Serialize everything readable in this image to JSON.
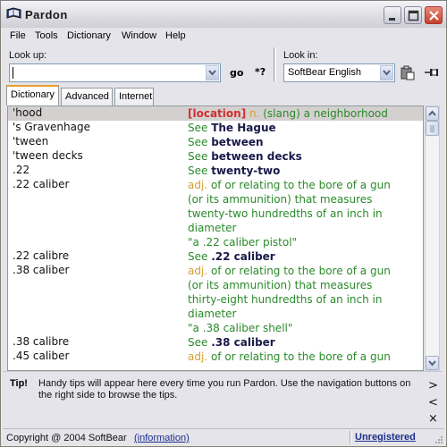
{
  "window": {
    "title": "Pardon",
    "icon": "book-icon"
  },
  "titlebar_buttons": {
    "minimize": "minimize-icon",
    "maximize": "maximize-icon",
    "close": "close-icon"
  },
  "menu": [
    "File",
    "Tools",
    "Dictionary",
    "Window",
    "Help"
  ],
  "lookup": {
    "label": "Look up:",
    "value": "",
    "go_label": "go",
    "wildcard_label": "*?"
  },
  "lookin": {
    "label": "Look in:",
    "value": "SoftBear English",
    "paste_icon": "clipboard-paste-icon",
    "pin_icon": "pin-icon"
  },
  "tabs": [
    "Dictionary",
    "Advanced",
    "Internet"
  ],
  "active_tab": "Dictionary",
  "entries": [
    {
      "term": "'hood",
      "selected": true,
      "lines": [
        [
          {
            "t": "tag",
            "v": "[location]"
          },
          {
            "t": "pos",
            "v": " n."
          },
          {
            "t": "txt",
            "v": " (slang) a neighborhood"
          }
        ]
      ]
    },
    {
      "term": "'s Gravenhage",
      "lines": [
        [
          {
            "t": "see",
            "v": "See "
          },
          {
            "t": "ref",
            "v": "The Hague"
          }
        ]
      ]
    },
    {
      "term": "'tween",
      "lines": [
        [
          {
            "t": "see",
            "v": "See "
          },
          {
            "t": "ref",
            "v": "between"
          }
        ]
      ]
    },
    {
      "term": "'tween decks",
      "lines": [
        [
          {
            "t": "see",
            "v": "See "
          },
          {
            "t": "ref",
            "v": "between decks"
          }
        ]
      ]
    },
    {
      "term": ".22",
      "lines": [
        [
          {
            "t": "see",
            "v": "See "
          },
          {
            "t": "ref",
            "v": "twenty-two"
          }
        ]
      ]
    },
    {
      "term": ".22 caliber",
      "lines": [
        [
          {
            "t": "pos",
            "v": "adj."
          },
          {
            "t": "txt",
            "v": " of or relating to the bore of a gun"
          }
        ],
        [
          {
            "t": "txt",
            "v": "(or its ammunition) that measures"
          }
        ],
        [
          {
            "t": "txt",
            "v": "twenty-two hundredths of an inch in"
          }
        ],
        [
          {
            "t": "txt",
            "v": "diameter"
          }
        ],
        [
          {
            "t": "txt",
            "v": "\"a .22 caliber pistol\""
          }
        ]
      ]
    },
    {
      "term": ".22 calibre",
      "lines": [
        [
          {
            "t": "see",
            "v": "See "
          },
          {
            "t": "ref",
            "v": ".22 caliber"
          }
        ]
      ]
    },
    {
      "term": ".38 caliber",
      "lines": [
        [
          {
            "t": "pos",
            "v": "adj."
          },
          {
            "t": "txt",
            "v": " of or relating to the bore of a gun"
          }
        ],
        [
          {
            "t": "txt",
            "v": "(or its ammunition) that measures"
          }
        ],
        [
          {
            "t": "txt",
            "v": "thirty-eight hundredths of an inch in"
          }
        ],
        [
          {
            "t": "txt",
            "v": "diameter"
          }
        ],
        [
          {
            "t": "txt",
            "v": "\"a .38 caliber shell\""
          }
        ]
      ]
    },
    {
      "term": ".38 calibre",
      "lines": [
        [
          {
            "t": "see",
            "v": "See "
          },
          {
            "t": "ref",
            "v": ".38 caliber"
          }
        ]
      ]
    },
    {
      "term": ".45 caliber",
      "lines": [
        [
          {
            "t": "pos",
            "v": "adj."
          },
          {
            "t": "txt",
            "v": " of or relating to the bore of a gun"
          }
        ]
      ]
    }
  ],
  "tip": {
    "label": "Tip!",
    "text": "Handy tips will appear here every time you run Pardon. Use the navigation buttons on the right side to browse the tips.",
    "next": ">",
    "prev": "<",
    "close": "×"
  },
  "status": {
    "copyright": "Copyright @ 2004 SoftBear",
    "info_link": "(information)",
    "registration": "Unregistered"
  },
  "colors": {
    "definition_text": "#2a8a2a",
    "part_of_speech": "#d4a030",
    "reference": "#1a1a4a",
    "tag": "#d03030",
    "link": "#1c2e8a",
    "selection": "#d4d0d0"
  }
}
